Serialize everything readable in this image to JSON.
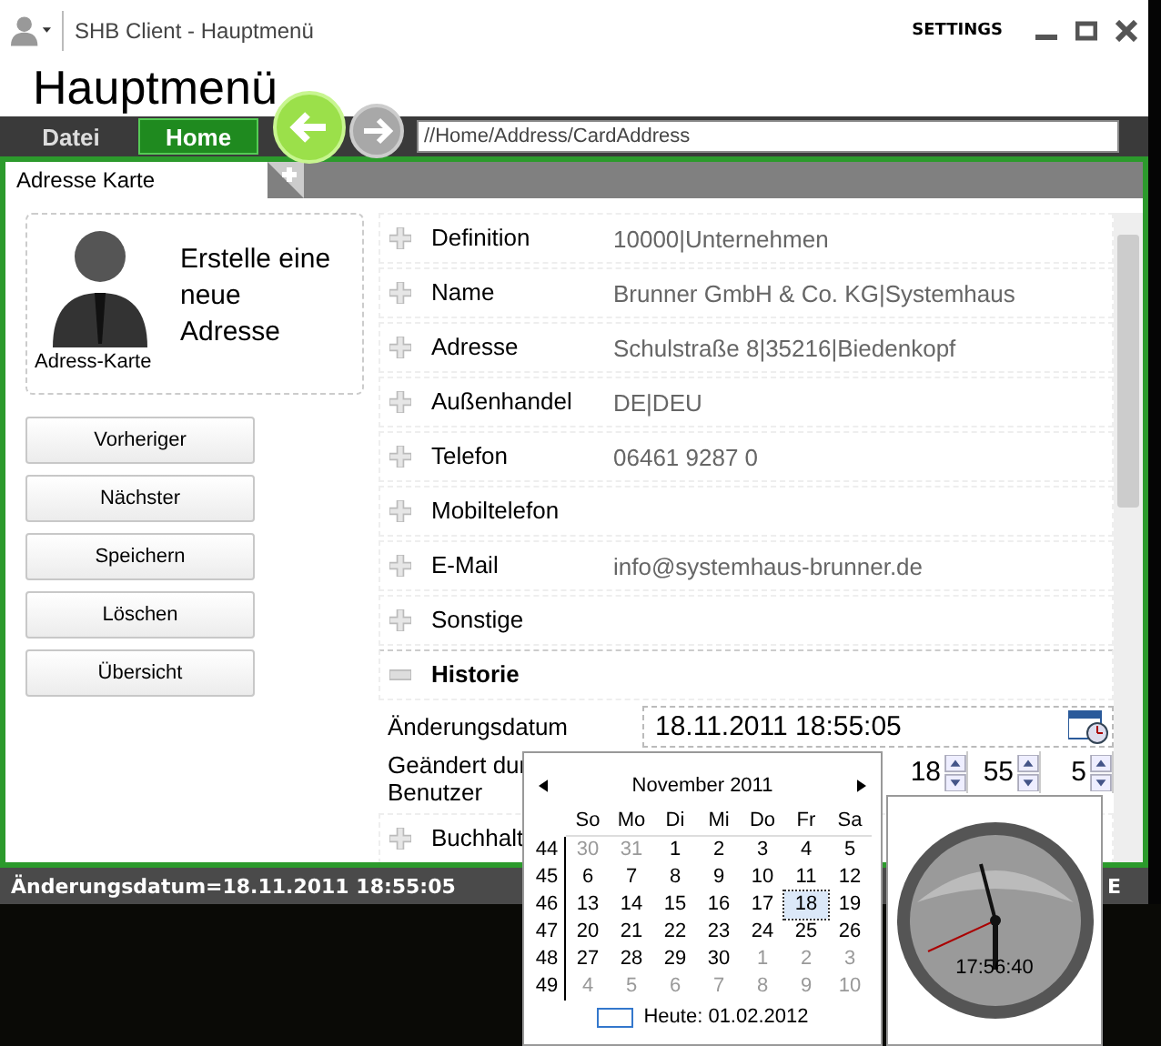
{
  "window": {
    "title": "SHB Client - Hauptmenü",
    "settings": "SETTINGS"
  },
  "page_title": "Hauptmenü",
  "menu": [
    {
      "label": "Datei",
      "selected": false
    },
    {
      "label": "Home",
      "selected": true
    }
  ],
  "address": "//Home/Address/CardAddress",
  "tabs": [
    {
      "label": "Adresse Karte",
      "selected": true
    }
  ],
  "card": {
    "text": "Erstelle eine neue Adresse",
    "caption": "Adress-Karte"
  },
  "buttons": [
    "Vorheriger",
    "Nächster",
    "Speichern",
    "Löschen",
    "Übersicht"
  ],
  "sections": [
    {
      "label": "Definition",
      "value": "10000|Unternehmen",
      "expanded": false
    },
    {
      "label": "Name",
      "value": "Brunner GmbH & Co. KG|Systemhaus",
      "expanded": false
    },
    {
      "label": "Adresse",
      "value": "Schulstraße 8|35216|Biedenkopf",
      "expanded": false
    },
    {
      "label": "Außenhandel",
      "value": "DE|DEU",
      "expanded": false
    },
    {
      "label": "Telefon",
      "value": "06461 9287 0",
      "expanded": false
    },
    {
      "label": "Mobiltelefon",
      "expanded": false
    },
    {
      "label": "E-Mail",
      "value": "info@systemhaus-brunner.de",
      "expanded": false
    },
    {
      "label": "Sonstige",
      "expanded": false
    },
    {
      "label": "Historie",
      "expanded": true,
      "date_label": "Änderungsdatum",
      "date_value": "18.11.2011 18:55:05",
      "changed_label": "Geändert dur",
      "changed_label_2": "Benutzer",
      "spinners": [
        "18",
        "55",
        "5"
      ]
    },
    {
      "label": "Buchhalt",
      "expanded": false
    }
  ],
  "status_bar": {
    "text": "Änderungsdatum=18.11.2011 18:55:05",
    "right": "E"
  },
  "calendar": {
    "month": "November 2011",
    "weekdays": [
      "So",
      "Mo",
      "Di",
      "Mi",
      "Do",
      "Fr",
      "Sa"
    ],
    "weeks": [
      {
        "number": "44",
        "days": [
          {
            "d": "30",
            "other": true,
            "selected": false
          },
          {
            "d": "31",
            "other": true,
            "selected": false
          },
          {
            "d": "1",
            "other": false,
            "selected": false
          },
          {
            "d": "2",
            "other": false,
            "selected": false
          },
          {
            "d": "3",
            "other": false,
            "selected": false
          },
          {
            "d": "4",
            "other": false,
            "selected": false
          },
          {
            "d": "5",
            "other": false,
            "selected": false
          }
        ]
      },
      {
        "number": "45",
        "days": [
          {
            "d": "6",
            "other": false,
            "selected": false
          },
          {
            "d": "7",
            "other": false,
            "selected": false
          },
          {
            "d": "8",
            "other": false,
            "selected": false
          },
          {
            "d": "9",
            "other": false,
            "selected": false
          },
          {
            "d": "10",
            "other": false,
            "selected": false
          },
          {
            "d": "11",
            "other": false,
            "selected": false
          },
          {
            "d": "12",
            "other": false,
            "selected": false
          }
        ]
      },
      {
        "number": "46",
        "days": [
          {
            "d": "13",
            "other": false,
            "selected": false
          },
          {
            "d": "14",
            "other": false,
            "selected": false
          },
          {
            "d": "15",
            "other": false,
            "selected": false
          },
          {
            "d": "16",
            "other": false,
            "selected": false
          },
          {
            "d": "17",
            "other": false,
            "selected": false
          },
          {
            "d": "18",
            "other": false,
            "selected": true
          },
          {
            "d": "19",
            "other": false,
            "selected": false
          }
        ]
      },
      {
        "number": "47",
        "days": [
          {
            "d": "20",
            "other": false,
            "selected": false
          },
          {
            "d": "21",
            "other": false,
            "selected": false
          },
          {
            "d": "22",
            "other": false,
            "selected": false
          },
          {
            "d": "23",
            "other": false,
            "selected": false
          },
          {
            "d": "24",
            "other": false,
            "selected": false
          },
          {
            "d": "25",
            "other": false,
            "selected": false
          },
          {
            "d": "26",
            "other": false,
            "selected": false
          }
        ]
      },
      {
        "number": "48",
        "days": [
          {
            "d": "27",
            "other": false,
            "selected": false
          },
          {
            "d": "28",
            "other": false,
            "selected": false
          },
          {
            "d": "29",
            "other": false,
            "selected": false
          },
          {
            "d": "30",
            "other": false,
            "selected": false
          },
          {
            "d": "1",
            "other": true,
            "selected": false
          },
          {
            "d": "2",
            "other": true,
            "selected": false
          },
          {
            "d": "3",
            "other": true,
            "selected": false
          }
        ]
      },
      {
        "number": "49",
        "days": [
          {
            "d": "4",
            "other": true,
            "selected": false
          },
          {
            "d": "5",
            "other": true,
            "selected": false
          },
          {
            "d": "6",
            "other": true,
            "selected": false
          },
          {
            "d": "7",
            "other": true,
            "selected": false
          },
          {
            "d": "8",
            "other": true,
            "selected": false
          },
          {
            "d": "9",
            "other": true,
            "selected": false
          },
          {
            "d": "10",
            "other": true,
            "selected": false
          }
        ]
      }
    ],
    "today": "Heute: 01.02.2012"
  },
  "clock": {
    "time": "17:56:40"
  }
}
